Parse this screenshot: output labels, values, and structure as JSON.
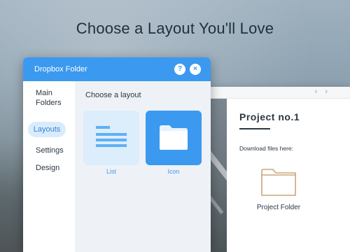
{
  "headline": "Choose a Layout You'll Love",
  "panel": {
    "title": "Dropbox Folder",
    "help_glyph": "?",
    "close_glyph": "×"
  },
  "sidebar": {
    "items": [
      {
        "label": "Main Folders"
      },
      {
        "label": "Layouts",
        "active": true
      },
      {
        "label": "Settings"
      },
      {
        "label": "Design"
      }
    ]
  },
  "main": {
    "choose_label": "Choose a layout",
    "options": [
      {
        "label": "List",
        "icon": "list-icon"
      },
      {
        "label": "Icon",
        "icon": "folder-icon",
        "selected": true
      }
    ]
  },
  "preview": {
    "nav_arrows": "‹ ›",
    "project_title": "Project no.1",
    "download_label": "Download files here:",
    "folder_label": "Project Folder"
  },
  "colors": {
    "accent": "#3b99f0",
    "active_nav_bg": "#d9ecfc",
    "text": "#2c3740",
    "folder_outline": "#c9a77a"
  }
}
